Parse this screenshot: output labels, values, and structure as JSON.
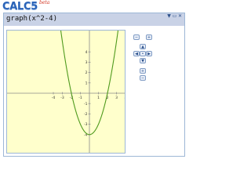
{
  "app": {
    "logo": "CALC5",
    "beta": "beta"
  },
  "expression": {
    "text": "graph(x^2-4)"
  },
  "window_buttons": [
    {
      "name": "minimize",
      "glyph": "▼"
    },
    {
      "name": "restore",
      "glyph": "▭"
    },
    {
      "name": "close",
      "glyph": "✕"
    }
  ],
  "controls": {
    "zoom_out_glyph": "−",
    "zoom_in_glyph": "+",
    "up_glyph": "▲",
    "down_glyph": "▼",
    "left_glyph": "◀",
    "right_glyph": "▶",
    "center_glyph": "•",
    "zoom_plus_glyph": "+",
    "zoom_minus_glyph": "−"
  },
  "chart_data": {
    "type": "line",
    "function": "x^2-4",
    "xlim": [
      -5,
      5
    ],
    "ylim": [
      -5,
      5
    ],
    "x_ticks": [
      -4,
      -3,
      -2,
      -1,
      1,
      2,
      3,
      4
    ],
    "y_ticks": [
      4,
      3,
      2,
      1,
      -1,
      -2,
      -3,
      -4
    ],
    "series_color": "#4f9a1d",
    "grid": false
  }
}
